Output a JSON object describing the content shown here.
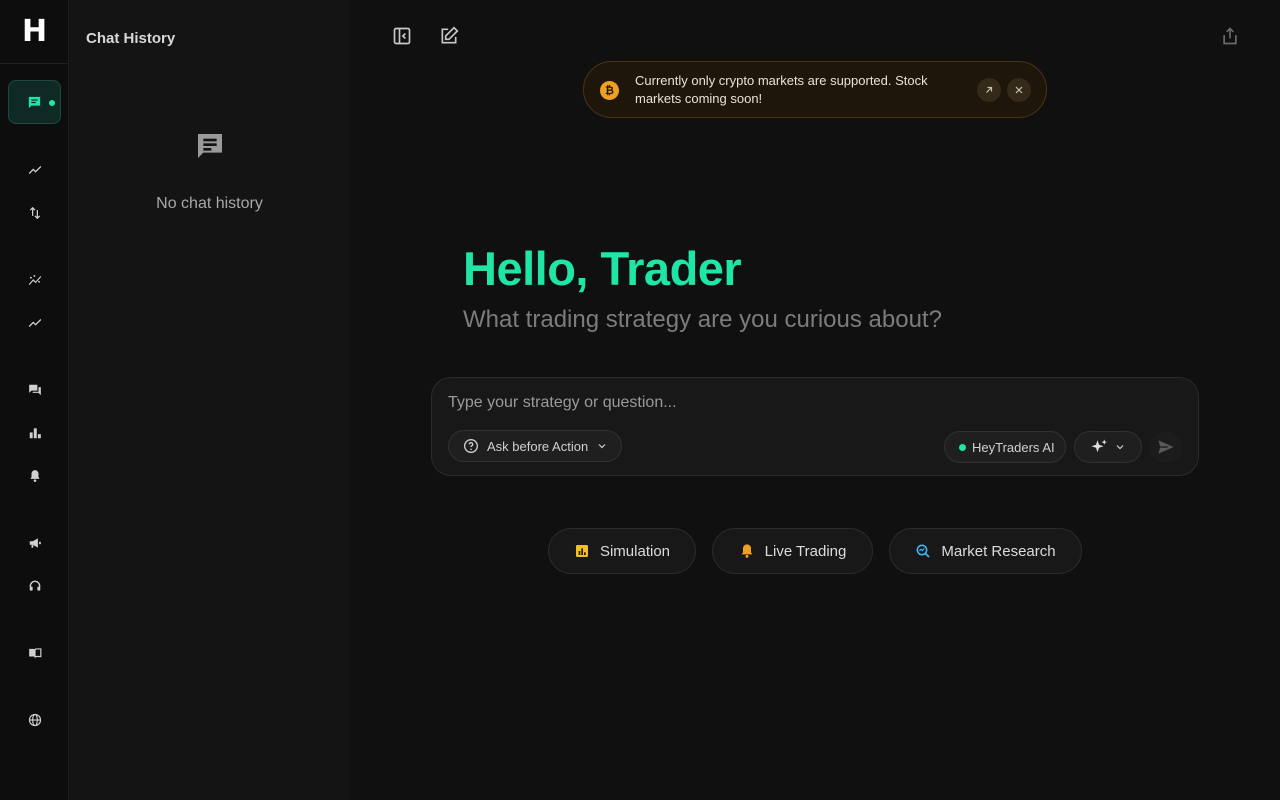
{
  "brand": {
    "logo_letter": "H"
  },
  "rail": {
    "items": [
      {
        "name": "chat",
        "icon": "chat-icon",
        "active": true
      },
      {
        "name": "trend",
        "icon": "trend-line-icon"
      },
      {
        "name": "trade",
        "icon": "swap-vertical-icon"
      },
      {
        "name": "analytics",
        "icon": "scatter-trend-icon"
      },
      {
        "name": "performance",
        "icon": "trend-line-icon"
      },
      {
        "name": "forum",
        "icon": "forum-icon"
      },
      {
        "name": "leaderboard",
        "icon": "bar-chart-icon"
      },
      {
        "name": "alerts",
        "icon": "bell-icon"
      },
      {
        "name": "announcements",
        "icon": "megaphone-icon"
      },
      {
        "name": "support",
        "icon": "headset-icon"
      },
      {
        "name": "docs",
        "icon": "book-icon"
      },
      {
        "name": "language",
        "icon": "globe-icon"
      }
    ]
  },
  "history": {
    "title": "Chat History",
    "empty_text": "No chat history"
  },
  "banner": {
    "text": "Currently only crypto markets are supported. Stock markets coming soon!",
    "coin_symbol": "₿"
  },
  "hero": {
    "greeting": "Hello, Trader",
    "subtitle": "What trading strategy are you curious about?"
  },
  "composer": {
    "placeholder": "Type your strategy or question...",
    "mode_label": "Ask before Action",
    "model_label": "HeyTraders AI"
  },
  "quick_actions": [
    {
      "label": "Simulation",
      "icon": "simulation-chart-icon"
    },
    {
      "label": "Live Trading",
      "icon": "bell-icon"
    },
    {
      "label": "Market Research",
      "icon": "research-search-icon"
    }
  ],
  "colors": {
    "accent": "#1fe6a6",
    "banner_bg": "#1e160a",
    "coin": "#f0a020"
  }
}
